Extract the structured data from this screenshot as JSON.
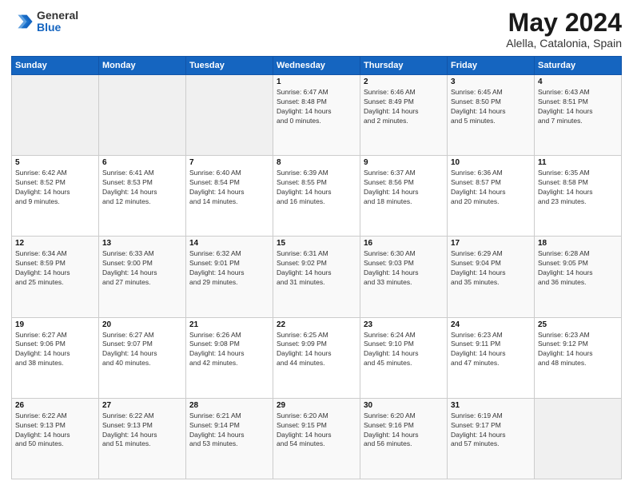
{
  "logo": {
    "general": "General",
    "blue": "Blue"
  },
  "title": {
    "month_year": "May 2024",
    "location": "Alella, Catalonia, Spain"
  },
  "days_of_week": [
    "Sunday",
    "Monday",
    "Tuesday",
    "Wednesday",
    "Thursday",
    "Friday",
    "Saturday"
  ],
  "weeks": [
    [
      {
        "day": "",
        "info": ""
      },
      {
        "day": "",
        "info": ""
      },
      {
        "day": "",
        "info": ""
      },
      {
        "day": "1",
        "info": "Sunrise: 6:47 AM\nSunset: 8:48 PM\nDaylight: 14 hours\nand 0 minutes."
      },
      {
        "day": "2",
        "info": "Sunrise: 6:46 AM\nSunset: 8:49 PM\nDaylight: 14 hours\nand 2 minutes."
      },
      {
        "day": "3",
        "info": "Sunrise: 6:45 AM\nSunset: 8:50 PM\nDaylight: 14 hours\nand 5 minutes."
      },
      {
        "day": "4",
        "info": "Sunrise: 6:43 AM\nSunset: 8:51 PM\nDaylight: 14 hours\nand 7 minutes."
      }
    ],
    [
      {
        "day": "5",
        "info": "Sunrise: 6:42 AM\nSunset: 8:52 PM\nDaylight: 14 hours\nand 9 minutes."
      },
      {
        "day": "6",
        "info": "Sunrise: 6:41 AM\nSunset: 8:53 PM\nDaylight: 14 hours\nand 12 minutes."
      },
      {
        "day": "7",
        "info": "Sunrise: 6:40 AM\nSunset: 8:54 PM\nDaylight: 14 hours\nand 14 minutes."
      },
      {
        "day": "8",
        "info": "Sunrise: 6:39 AM\nSunset: 8:55 PM\nDaylight: 14 hours\nand 16 minutes."
      },
      {
        "day": "9",
        "info": "Sunrise: 6:37 AM\nSunset: 8:56 PM\nDaylight: 14 hours\nand 18 minutes."
      },
      {
        "day": "10",
        "info": "Sunrise: 6:36 AM\nSunset: 8:57 PM\nDaylight: 14 hours\nand 20 minutes."
      },
      {
        "day": "11",
        "info": "Sunrise: 6:35 AM\nSunset: 8:58 PM\nDaylight: 14 hours\nand 23 minutes."
      }
    ],
    [
      {
        "day": "12",
        "info": "Sunrise: 6:34 AM\nSunset: 8:59 PM\nDaylight: 14 hours\nand 25 minutes."
      },
      {
        "day": "13",
        "info": "Sunrise: 6:33 AM\nSunset: 9:00 PM\nDaylight: 14 hours\nand 27 minutes."
      },
      {
        "day": "14",
        "info": "Sunrise: 6:32 AM\nSunset: 9:01 PM\nDaylight: 14 hours\nand 29 minutes."
      },
      {
        "day": "15",
        "info": "Sunrise: 6:31 AM\nSunset: 9:02 PM\nDaylight: 14 hours\nand 31 minutes."
      },
      {
        "day": "16",
        "info": "Sunrise: 6:30 AM\nSunset: 9:03 PM\nDaylight: 14 hours\nand 33 minutes."
      },
      {
        "day": "17",
        "info": "Sunrise: 6:29 AM\nSunset: 9:04 PM\nDaylight: 14 hours\nand 35 minutes."
      },
      {
        "day": "18",
        "info": "Sunrise: 6:28 AM\nSunset: 9:05 PM\nDaylight: 14 hours\nand 36 minutes."
      }
    ],
    [
      {
        "day": "19",
        "info": "Sunrise: 6:27 AM\nSunset: 9:06 PM\nDaylight: 14 hours\nand 38 minutes."
      },
      {
        "day": "20",
        "info": "Sunrise: 6:27 AM\nSunset: 9:07 PM\nDaylight: 14 hours\nand 40 minutes."
      },
      {
        "day": "21",
        "info": "Sunrise: 6:26 AM\nSunset: 9:08 PM\nDaylight: 14 hours\nand 42 minutes."
      },
      {
        "day": "22",
        "info": "Sunrise: 6:25 AM\nSunset: 9:09 PM\nDaylight: 14 hours\nand 44 minutes."
      },
      {
        "day": "23",
        "info": "Sunrise: 6:24 AM\nSunset: 9:10 PM\nDaylight: 14 hours\nand 45 minutes."
      },
      {
        "day": "24",
        "info": "Sunrise: 6:23 AM\nSunset: 9:11 PM\nDaylight: 14 hours\nand 47 minutes."
      },
      {
        "day": "25",
        "info": "Sunrise: 6:23 AM\nSunset: 9:12 PM\nDaylight: 14 hours\nand 48 minutes."
      }
    ],
    [
      {
        "day": "26",
        "info": "Sunrise: 6:22 AM\nSunset: 9:13 PM\nDaylight: 14 hours\nand 50 minutes."
      },
      {
        "day": "27",
        "info": "Sunrise: 6:22 AM\nSunset: 9:13 PM\nDaylight: 14 hours\nand 51 minutes."
      },
      {
        "day": "28",
        "info": "Sunrise: 6:21 AM\nSunset: 9:14 PM\nDaylight: 14 hours\nand 53 minutes."
      },
      {
        "day": "29",
        "info": "Sunrise: 6:20 AM\nSunset: 9:15 PM\nDaylight: 14 hours\nand 54 minutes."
      },
      {
        "day": "30",
        "info": "Sunrise: 6:20 AM\nSunset: 9:16 PM\nDaylight: 14 hours\nand 56 minutes."
      },
      {
        "day": "31",
        "info": "Sunrise: 6:19 AM\nSunset: 9:17 PM\nDaylight: 14 hours\nand 57 minutes."
      },
      {
        "day": "",
        "info": ""
      }
    ]
  ]
}
